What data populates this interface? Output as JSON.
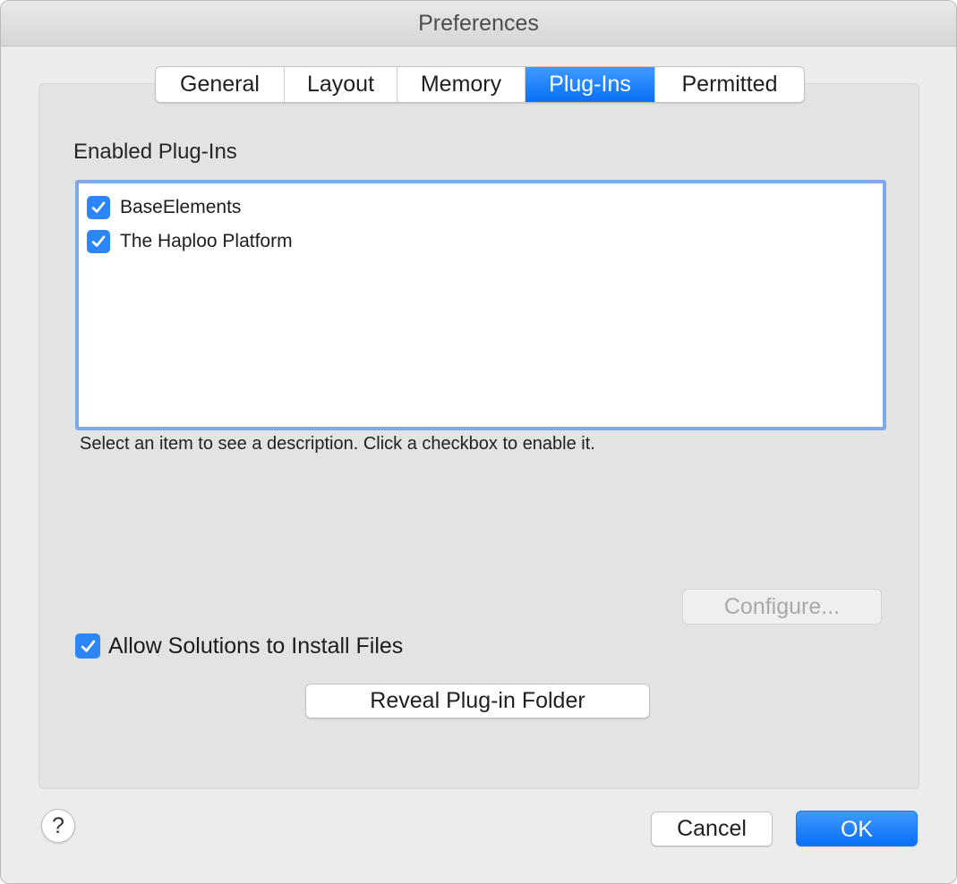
{
  "window": {
    "title": "Preferences"
  },
  "tabs": [
    {
      "label": "General",
      "active": false
    },
    {
      "label": "Layout",
      "active": false
    },
    {
      "label": "Memory",
      "active": false
    },
    {
      "label": "Plug-Ins",
      "active": true
    },
    {
      "label": "Permitted",
      "active": false
    }
  ],
  "plugins": {
    "section_label": "Enabled Plug-Ins",
    "items": [
      {
        "label": "BaseElements",
        "checked": true
      },
      {
        "label": "The Haploo Platform",
        "checked": true
      }
    ],
    "hint": "Select an item to see a description. Click a checkbox to enable it.",
    "configure_label": "Configure...",
    "configure_enabled": false,
    "allow_install_label": "Allow Solutions to Install Files",
    "allow_install_checked": true,
    "reveal_label": "Reveal Plug-in Folder"
  },
  "footer": {
    "help_label": "?",
    "cancel_label": "Cancel",
    "ok_label": "OK"
  },
  "colors": {
    "accent": "#0a6ff5",
    "checkbox": "#2d86f8",
    "focus_ring": "#7fa9e6",
    "window_bg": "#ececec",
    "panel_bg": "#e3e3e3"
  },
  "icons": {
    "checkbox": "checkmark-icon",
    "help": "question-mark-icon"
  }
}
